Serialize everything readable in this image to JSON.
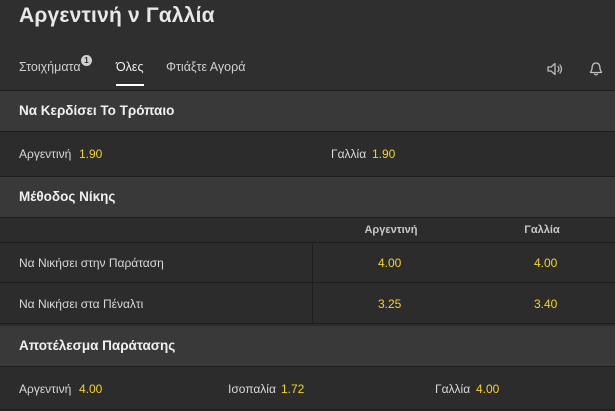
{
  "page": {
    "title": "Αργεντινή ν Γαλλία"
  },
  "tabs": {
    "bets": {
      "label": "Στοιχήματα",
      "badge": "1"
    },
    "all": {
      "label": "Όλες"
    },
    "build": {
      "label": "Φτιάξτε Αγορά"
    }
  },
  "icons": {
    "sound": "speaker-icon",
    "notify": "bell-icon"
  },
  "colors": {
    "odds": "#f5d328",
    "section_bg": "#393939",
    "page_bg": "#2c2c2c"
  },
  "markets": {
    "tournament": {
      "title": "Να Κερδίσει Το Τρόπαιο",
      "selections": [
        {
          "name": "Αργεντινή",
          "odds": "1.90"
        },
        {
          "name": "Γαλλία",
          "odds": "1.90"
        }
      ]
    },
    "method": {
      "title": "Μέθοδος Νίκης",
      "columns": [
        "Αργεντινή",
        "Γαλλία"
      ],
      "rows": [
        {
          "label": "Να Νικήσει στην Παράταση",
          "odds": [
            "4.00",
            "4.00"
          ]
        },
        {
          "label": "Να Νικήσει στα Πέναλτι",
          "odds": [
            "3.25",
            "3.40"
          ]
        }
      ]
    },
    "extra_time": {
      "title": "Αποτέλεσμα Παράτασης",
      "selections": [
        {
          "name": "Αργεντινή",
          "odds": "4.00"
        },
        {
          "name": "Ισοπαλία",
          "odds": "1.72"
        },
        {
          "name": "Γαλλία",
          "odds": "4.00"
        }
      ]
    }
  }
}
